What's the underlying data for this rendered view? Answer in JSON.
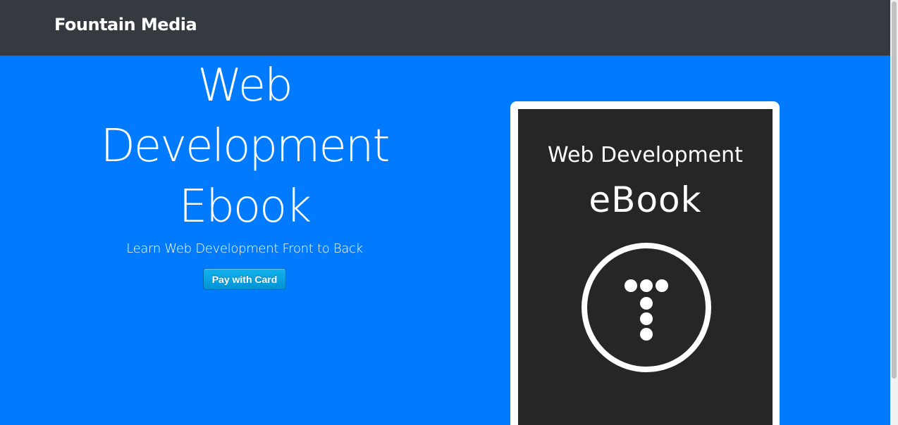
{
  "navbar": {
    "brand": "Fountain Media"
  },
  "hero": {
    "title_lines": [
      "Web",
      "Development",
      "Ebook"
    ],
    "subtitle": "Learn Web Development Front to Back",
    "pay_button_label": "Pay with Card"
  },
  "book_cover": {
    "title": "Web Development",
    "subtitle": "eBook",
    "logo_icon": "circle-t-dots-icon"
  },
  "colors": {
    "navbar_bg": "#343a40",
    "hero_bg": "#007bff",
    "cover_bg": "#262626",
    "button_bg": "#0392d3"
  }
}
